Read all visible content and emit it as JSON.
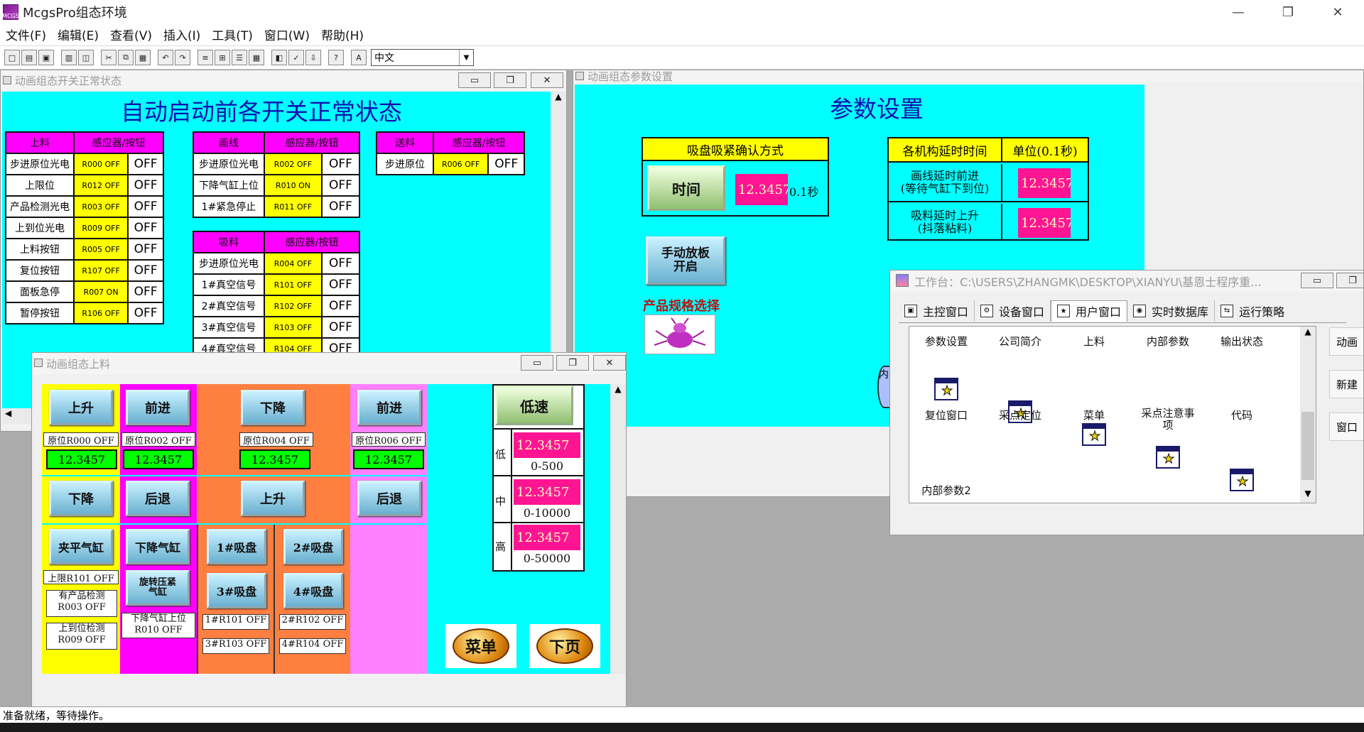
{
  "app": {
    "title": "McgsPro组态环境",
    "icon_label": "MCGS"
  },
  "window_controls": {
    "minimize": "—",
    "restore": "❐",
    "close": "✕"
  },
  "menu": [
    "文件(F)",
    "编辑(E)",
    "查看(V)",
    "插入(I)",
    "工具(T)",
    "窗口(W)",
    "帮助(H)"
  ],
  "toolbar": {
    "language": "中文"
  },
  "status": "准备就绪，等待操作。",
  "win_switch": {
    "title": "动画组态开关正常状态",
    "heading": "自动启动前各开关正常状态",
    "table1": {
      "headers": [
        "上料",
        "感应器/按钮"
      ],
      "rows": [
        [
          "步进原位光电",
          "R000 OFF",
          "OFF"
        ],
        [
          "上限位",
          "R012 OFF",
          "OFF"
        ],
        [
          "产品检测光电",
          "R003 OFF",
          "OFF"
        ],
        [
          "上到位光电",
          "R009 OFF",
          "OFF"
        ],
        [
          "上料按钮",
          "R005 OFF",
          "OFF"
        ],
        [
          "复位按钮",
          "R107 OFF",
          "OFF"
        ],
        [
          "面板急停",
          "R007 ON",
          "OFF"
        ],
        [
          "暂停按钮",
          "R106 OFF",
          "OFF"
        ]
      ]
    },
    "table2": {
      "headers": [
        "画线",
        "感应器/按钮"
      ],
      "rows": [
        [
          "步进原位光电",
          "R002 OFF",
          "OFF"
        ],
        [
          "下降气缸上位",
          "R010 ON",
          "OFF"
        ],
        [
          "1#紧急停止",
          "R011 OFF",
          "OFF"
        ]
      ]
    },
    "table3": {
      "headers": [
        "送料",
        "感应器/按钮"
      ],
      "rows": [
        [
          "步进原位",
          "R006 OFF",
          "OFF"
        ]
      ]
    },
    "table4": {
      "headers": [
        "吸料",
        "感应器/按钮"
      ],
      "rows": [
        [
          "步进原位光电",
          "R004 OFF",
          "OFF"
        ],
        [
          "1#真空信号",
          "R101 OFF",
          "OFF"
        ],
        [
          "2#真空信号",
          "R102 OFF",
          "OFF"
        ],
        [
          "3#真空信号",
          "R103 OFF",
          "OFF"
        ],
        [
          "4#真空信号",
          "R104 OFF",
          "OFF"
        ]
      ]
    }
  },
  "win_param": {
    "title": "动画组态参数设置",
    "heading": "参数设置",
    "suction_header": "吸盘吸紧确认方式",
    "time_button": "时间",
    "time_value": "12.3457",
    "time_unit": "0.1秒",
    "delay_header": "各机构延时时间",
    "unit_header": "单位(0.1秒)",
    "delay_rows": [
      {
        "label": "画线延时前进\n(等待气缸下到位)",
        "value": "12.3457"
      },
      {
        "label": "吸料延时上升\n(抖落粘料)",
        "value": "12.3457"
      }
    ],
    "manual_button": "手动放板\n开启",
    "spec_label": "产品规格选择"
  },
  "win_feed": {
    "title": "动画组态上料",
    "buttons": {
      "up": "上升",
      "forward": "前进",
      "down_center": "下降",
      "forward2": "前进",
      "down": "下降",
      "back": "后退",
      "up2": "上升",
      "back2": "后退",
      "clamp": "夹平气缸",
      "lower_cyl": "下降气缸",
      "s1": "1#吸盘",
      "s2": "2#吸盘",
      "rotate": "旋转压紧\n气缸",
      "s3": "3#吸盘",
      "s4": "4#吸盘",
      "low_speed": "低速",
      "menu": "菜单",
      "next": "下页"
    },
    "pos_labels": [
      "原位R000 OFF",
      "原位R002 OFF",
      "原位R004 OFF",
      "原位R006 OFF"
    ],
    "values": [
      "12.3457",
      "12.3457",
      "12.3457",
      "12.3457"
    ],
    "status_labels": {
      "upper": "上限R101 OFF",
      "product": "有产品检测\nR003 OFF",
      "arrive": "上到位检测\nR009 OFF",
      "lower_up": "下降气缸上位\nR010 OFF",
      "r101": "1#R101 OFF",
      "r102": "2#R102 OFF",
      "r103": "3#R103 OFF",
      "r104": "4#R104 OFF"
    },
    "speeds": [
      {
        "label": "低",
        "value": "12.3457",
        "range": "0-500"
      },
      {
        "label": "中",
        "value": "12.3457",
        "range": "0-10000"
      },
      {
        "label": "高",
        "value": "12.3457",
        "range": "0-50000"
      }
    ]
  },
  "workspace": {
    "title": "工作台：C:\\USERS\\ZHANGMK\\DESKTOP\\XIANYU\\基恩士程序重...",
    "tabs": [
      "主控窗口",
      "设备窗口",
      "用户窗口",
      "实时数据库",
      "运行策略"
    ],
    "items_row1": [
      "参数设置",
      "公司简介",
      "上料",
      "内部参数",
      "输出状态"
    ],
    "items_row2": [
      "复位窗口",
      "采点定位",
      "菜单",
      "采点注意事\n项",
      "代码"
    ],
    "items_row3": [
      "内部参数2"
    ],
    "side_buttons": [
      "动画",
      "新建",
      "窗口"
    ]
  }
}
